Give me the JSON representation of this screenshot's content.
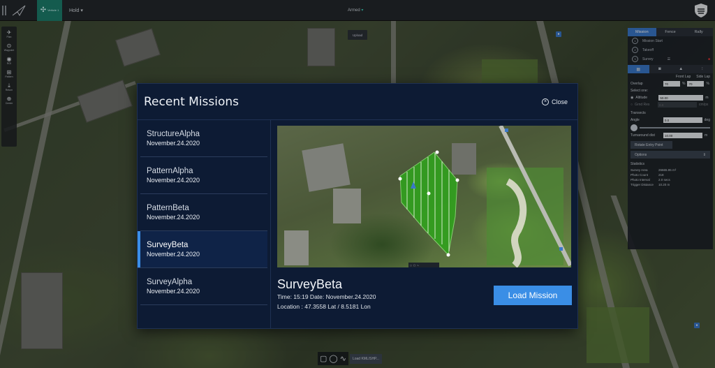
{
  "topbar": {
    "vehicle_label": "Vehicle 1",
    "flight_mode": "Hold",
    "armed_status": "Armed"
  },
  "left_tools": [
    {
      "label": "Plan",
      "icon": "plan-icon"
    },
    {
      "label": "Waypoint",
      "icon": "waypoint-icon"
    },
    {
      "label": "ROI",
      "icon": "roi-icon"
    },
    {
      "label": "Pattern",
      "icon": "pattern-icon"
    },
    {
      "label": "Return",
      "icon": "return-icon"
    },
    {
      "label": "Center",
      "icon": "center-icon"
    }
  ],
  "upload_label": "Upload",
  "right_panel": {
    "tabs": [
      "Mission",
      "Fence",
      "Rally"
    ],
    "steps": [
      {
        "num": "1",
        "label": "Mission Start"
      },
      {
        "num": "2",
        "label": "Takeoff"
      },
      {
        "num": "3",
        "label": "Survey"
      }
    ],
    "front_lap_label": "Front Lap",
    "side_lap_label": "Side Lap",
    "overlap_label": "Overlap",
    "front_lap_value": "70",
    "side_lap_value": "70",
    "percent": "%",
    "select_one": "Select one:",
    "altitude_label": "Altitude",
    "altitude_value": "50.00",
    "altitude_unit": "m",
    "grnd_res_label": "Grnd Res",
    "grnd_res_value": "0.0",
    "grnd_res_unit": "cm/px",
    "transects_label": "Transects",
    "angle_label": "Angle",
    "angle_value": "0.0",
    "angle_unit": "deg",
    "turnaround_label": "Turnaround dist",
    "turnaround_value": "10.00",
    "turnaround_unit": "m",
    "rotate_entry": "Rotate Entry Point",
    "options": "Options",
    "statistics_label": "Statistics",
    "stats": [
      {
        "k": "Survey Area",
        "v": "26665.95 m²"
      },
      {
        "k": "Photo Count",
        "v": "218"
      },
      {
        "k": "Photo Interval",
        "v": "2.0 secs"
      },
      {
        "k": "Trigger Distance",
        "v": "10.20 m"
      }
    ]
  },
  "modal": {
    "title": "Recent Missions",
    "close_label": "Close",
    "missions": [
      {
        "name": "StructureAlpha",
        "date": "November.24.2020"
      },
      {
        "name": "PatternAlpha",
        "date": "November.24.2020"
      },
      {
        "name": "PatternBeta",
        "date": "November.24.2020"
      },
      {
        "name": "SurveyBeta",
        "date": "November.24.2020"
      },
      {
        "name": "SurveyAlpha",
        "date": "November.24.2020"
      }
    ],
    "selected_index": 3,
    "detail": {
      "name": "SurveyBeta",
      "time_line": "Time: 15:19 Date: November.24.2020",
      "location_line": "Location : 47.3558 Lat / 8.5181 Lon"
    },
    "load_button": "Load Mission"
  },
  "bottom": {
    "load_kml": "Load KML/SHP..."
  },
  "colors": {
    "accent": "#3a8ee6",
    "modal_bg": "#0d1b34",
    "survey_fill": "#2fa51c"
  }
}
